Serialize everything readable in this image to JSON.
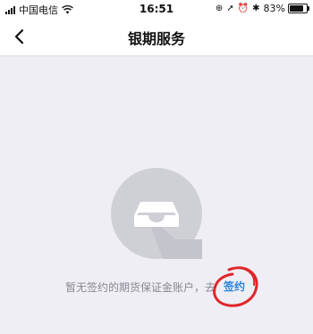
{
  "status_bar": {
    "carrier": "中国电信",
    "time": "16:51",
    "battery_percent": "83%",
    "battery_level": 0.83
  },
  "nav": {
    "title": "银期服务"
  },
  "empty_state": {
    "message": "暂无签约的期货保证金账户，去",
    "action_label": "签约",
    "action_color": "#2a82d9",
    "annotation_color": "#e0262a"
  }
}
